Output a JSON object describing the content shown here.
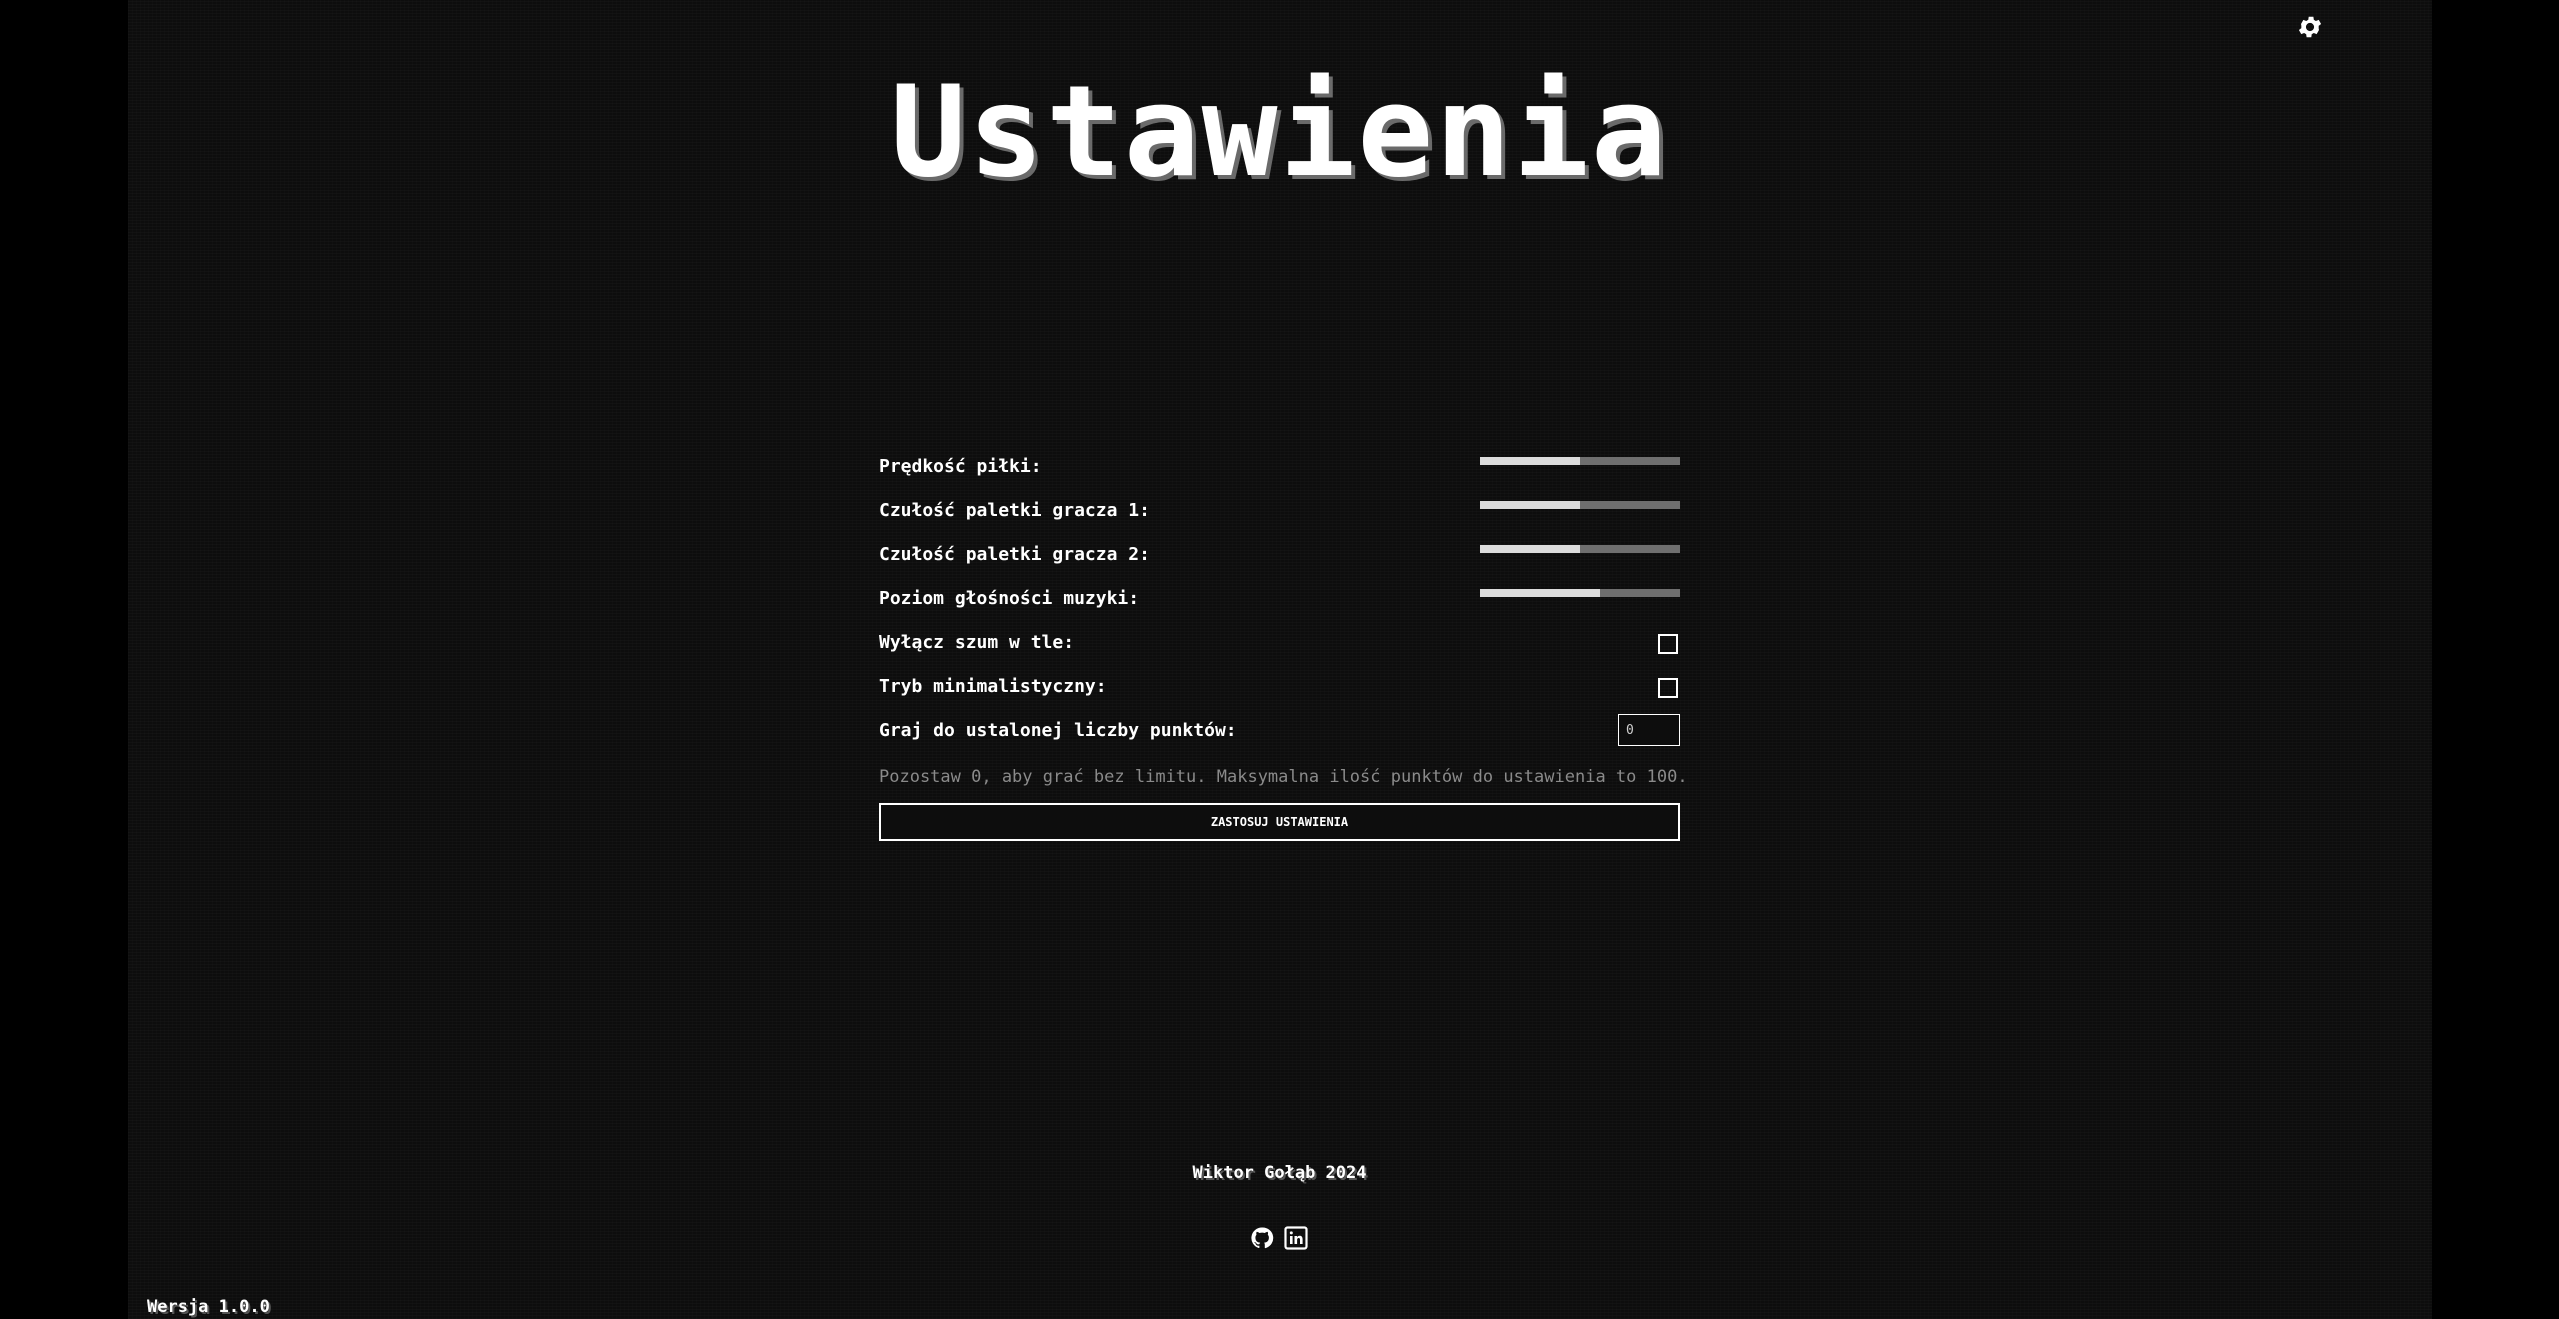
{
  "header": {
    "title": "Ustawienia",
    "settings_icon": "gear-icon"
  },
  "settings": {
    "ball_speed": {
      "label": "Prędkość piłki:",
      "value_fraction": 0.5
    },
    "paddle1_sensitivity": {
      "label": "Czułość paletki gracza 1:",
      "value_fraction": 0.5
    },
    "paddle2_sensitivity": {
      "label": "Czułość paletki gracza 2:",
      "value_fraction": 0.5
    },
    "music_volume": {
      "label": "Poziom głośności muzyki:",
      "value_fraction": 0.6
    },
    "disable_noise": {
      "label": "Wyłącz szum w tle:",
      "checked": false
    },
    "minimal_mode": {
      "label": "Tryb minimalistyczny:",
      "checked": false
    },
    "points_limit": {
      "label": "Graj do ustalonej liczby punktów:",
      "value": "0"
    },
    "hint": "Pozostaw 0, aby grać bez limitu. Maksymalna ilość punktów do ustawienia to 100.",
    "apply_label": "ZASTOSUJ USTAWIENIA"
  },
  "footer": {
    "author": "Wiktor Gołąb 2024",
    "icons": [
      "github-icon",
      "linkedin-icon"
    ],
    "version": "Wersja 1.0.0"
  },
  "colors": {
    "background": "#000000",
    "panel_background": "#0d0d0d",
    "text": "#ffffff",
    "hint_text": "#8a8a8a",
    "slider_track": "#6f6f6f",
    "slider_fill": "#dcdcdc"
  }
}
